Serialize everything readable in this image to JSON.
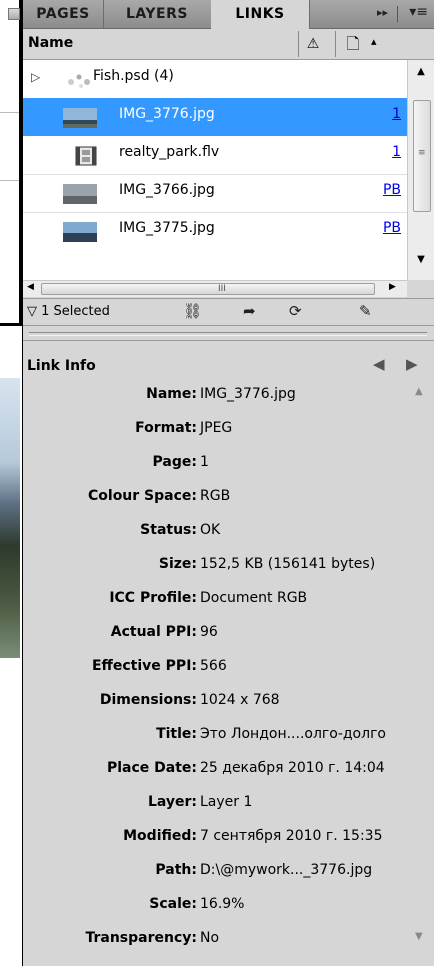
{
  "tabs": [
    {
      "label": "PAGES"
    },
    {
      "label": "LAYERS"
    },
    {
      "label": "LINKS"
    }
  ],
  "tabbar": {
    "expand_icon": "▸▸",
    "menu_icon": "▾≡"
  },
  "header": {
    "name_label": "Name",
    "warn_icon": "⚠",
    "page_icon": "🗋",
    "sort_icon": "▴"
  },
  "links": [
    {
      "expand": "▷",
      "name": "Fish.psd (4)",
      "page": "",
      "thumb": "group",
      "selected": false
    },
    {
      "expand": "",
      "name": "IMG_3776.jpg",
      "page": "1",
      "thumb": "photo-landscape",
      "selected": true
    },
    {
      "expand": "",
      "name": "realty_park.flv",
      "page": "1",
      "thumb": "film",
      "selected": false
    },
    {
      "expand": "",
      "name": "IMG_3766.jpg",
      "page": "PB",
      "thumb": "photo-grey",
      "selected": false
    },
    {
      "expand": "",
      "name": "IMG_3775.jpg",
      "page": "PB",
      "thumb": "photo-sky",
      "selected": false
    }
  ],
  "scroll": {
    "up": "▲",
    "down": "▼",
    "left": "◀",
    "right": "▶",
    "grip": "III"
  },
  "status": {
    "selected_text": "▽ 1 Selected",
    "relink_icon": "⛓",
    "goto_icon": "➦",
    "update_icon": "⟳",
    "edit_icon": "✎"
  },
  "link_info": {
    "title": "Link Info",
    "prev_icon": "◀",
    "next_icon": "▶",
    "rows": [
      {
        "key": "Name:",
        "value": "IMG_3776.jpg"
      },
      {
        "key": "Format:",
        "value": "JPEG"
      },
      {
        "key": "Page:",
        "value": "1"
      },
      {
        "key": "Colour Space:",
        "value": "RGB"
      },
      {
        "key": "Status:",
        "value": "OK"
      },
      {
        "key": "Size:",
        "value": "152,5 KB (156141 bytes)"
      },
      {
        "key": "ICC Profile:",
        "value": "Document RGB"
      },
      {
        "key": "Actual PPI:",
        "value": "96"
      },
      {
        "key": "Effective PPI:",
        "value": "566"
      },
      {
        "key": "Dimensions:",
        "value": "1024 x 768"
      },
      {
        "key": "Title:",
        "value": "Это Лондон....олго-долго"
      },
      {
        "key": "Place Date:",
        "value": "25 декабря 2010 г. 14:04"
      },
      {
        "key": "Layer:",
        "value": "Layer 1"
      },
      {
        "key": "Modified:",
        "value": "7 сентября 2010 г. 15:35"
      },
      {
        "key": "Path:",
        "value": "D:\\@mywork..._3776.jpg"
      },
      {
        "key": "Scale:",
        "value": "16.9%"
      },
      {
        "key": "Transparency:",
        "value": "No"
      }
    ]
  },
  "colors": {
    "selection": "#3398ff",
    "panel": "#d6d6d6",
    "link": "#0000ee"
  }
}
